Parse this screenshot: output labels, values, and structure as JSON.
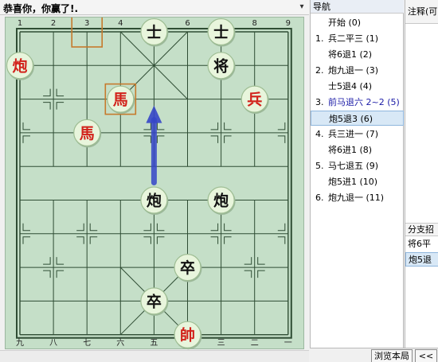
{
  "board_title": "恭喜你，你赢了!.",
  "pane_menu_icon": "▾",
  "board": {
    "files_top": [
      "1",
      "2",
      "3",
      "4",
      "5",
      "6",
      "7",
      "8",
      "9"
    ],
    "files_bottom": [
      "九",
      "八",
      "七",
      "六",
      "五",
      "四",
      "三",
      "二",
      "一"
    ],
    "pieces": [
      {
        "id": "black-advisor-1",
        "char": "士",
        "side": "black",
        "file": 4,
        "rank": 0
      },
      {
        "id": "black-advisor-2",
        "char": "士",
        "side": "black",
        "file": 6,
        "rank": 0
      },
      {
        "id": "black-general",
        "char": "将",
        "side": "black",
        "file": 6,
        "rank": 1
      },
      {
        "id": "red-cannon-1",
        "char": "炮",
        "side": "red",
        "file": 0,
        "rank": 1
      },
      {
        "id": "red-horse-1",
        "char": "馬",
        "side": "red",
        "file": 3,
        "rank": 2
      },
      {
        "id": "red-soldier",
        "char": "兵",
        "side": "red",
        "file": 7,
        "rank": 2
      },
      {
        "id": "red-horse-2",
        "char": "馬",
        "side": "red",
        "file": 2,
        "rank": 3
      },
      {
        "id": "black-cannon-1",
        "char": "炮",
        "side": "black",
        "file": 4,
        "rank": 5
      },
      {
        "id": "black-cannon-2",
        "char": "炮",
        "side": "black",
        "file": 6,
        "rank": 5
      },
      {
        "id": "black-pawn-1",
        "char": "卒",
        "side": "black",
        "file": 5,
        "rank": 7
      },
      {
        "id": "black-pawn-2",
        "char": "卒",
        "side": "black",
        "file": 4,
        "rank": 8
      },
      {
        "id": "red-king",
        "char": "帥",
        "side": "red",
        "file": 5,
        "rank": 9
      }
    ],
    "highlights": [
      {
        "file": 2,
        "rank": 0
      },
      {
        "file": 3,
        "rank": 2
      }
    ],
    "arrow": {
      "from": {
        "file": 4,
        "rank": 5
      },
      "to": {
        "file": 4,
        "rank": 2
      }
    },
    "colors": {
      "board": "#c5dfc8",
      "line": "#2f4d34",
      "piece_fill": "#e8f5dc",
      "piece_edge": "#9ebd93",
      "red": "#d2221b",
      "black": "#111111",
      "highlight": "#c67a2c",
      "arrow": "#3546c8"
    }
  },
  "nav": {
    "header": "导航",
    "moves": [
      {
        "num": "",
        "text": "开始 (0)",
        "branch": false,
        "selected": false
      },
      {
        "num": "1.",
        "text": "兵二平三 (1)",
        "branch": false,
        "selected": false
      },
      {
        "num": "",
        "text": "将6退1 (2)",
        "branch": false,
        "selected": false
      },
      {
        "num": "2.",
        "text": "炮九退一 (3)",
        "branch": false,
        "selected": false
      },
      {
        "num": "",
        "text": "士5退4 (4)",
        "branch": false,
        "selected": false
      },
      {
        "num": "3.",
        "text": "前马退六 2~2 (5)",
        "branch": true,
        "selected": false
      },
      {
        "num": "",
        "text": "炮5退3 (6)",
        "branch": false,
        "selected": true
      },
      {
        "num": "4.",
        "text": "兵三进一 (7)",
        "branch": false,
        "selected": false
      },
      {
        "num": "",
        "text": "将6进1 (8)",
        "branch": false,
        "selected": false
      },
      {
        "num": "5.",
        "text": "马七退五 (9)",
        "branch": false,
        "selected": false
      },
      {
        "num": "",
        "text": "炮5进1 (10)",
        "branch": false,
        "selected": false
      },
      {
        "num": "6.",
        "text": "炮九退一 (11)",
        "branch": false,
        "selected": false
      }
    ]
  },
  "notes": {
    "header": "注释(可",
    "branch_header": "分支招",
    "branches": [
      {
        "text": "将6平",
        "selected": false
      },
      {
        "text": "炮5退",
        "selected": true
      }
    ]
  },
  "buttons": {
    "browse": "浏览本局",
    "prev": "<<"
  }
}
